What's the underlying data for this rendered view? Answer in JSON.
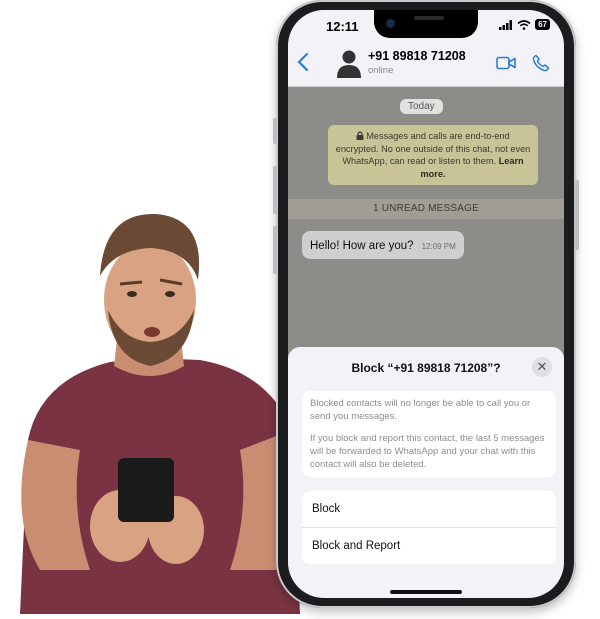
{
  "status_bar": {
    "time": "12:11",
    "battery": "67"
  },
  "chat_header": {
    "contact_name": "+91 89818 71208",
    "contact_status": "online"
  },
  "chat": {
    "date_chip": "Today",
    "encryption_notice": "Messages and calls are end-to-end encrypted. No one outside of this chat, not even WhatsApp, can read or listen to them.",
    "encryption_link": "Learn more.",
    "unread_banner": "1 UNREAD MESSAGE",
    "message": {
      "text": "Hello! How are you?",
      "time": "12:09 PM"
    }
  },
  "block_sheet": {
    "title": "Block “+91 89818 71208”?",
    "info_1": "Blocked contacts will no longer be able to call you or send you messages.",
    "info_2": "If you block and report this contact, the last 5 messages will be forwarded to WhatsApp and your chat with this contact will also be deleted.",
    "actions": [
      "Block",
      "Block and Report"
    ]
  },
  "colors": {
    "accent": "#2a7fd4",
    "chat_bg": "#8c8c89",
    "notice_bg": "#c9c497"
  }
}
